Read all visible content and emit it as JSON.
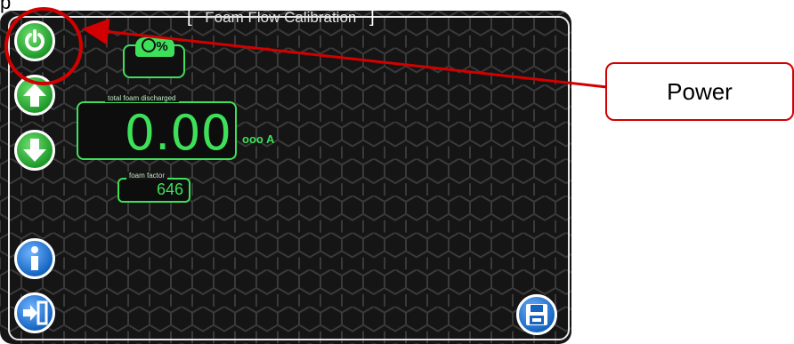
{
  "title_bar": {
    "fragment": "p",
    "title": "Foam Flow Calibration",
    "bracket_left": "[",
    "bracket_right": "]"
  },
  "sidebar": {
    "buttons": [
      {
        "name": "power",
        "icon": "power-icon",
        "color": "#2aa83a"
      },
      {
        "name": "up",
        "icon": "arrow-up-icon",
        "color": "#2aa83a"
      },
      {
        "name": "down",
        "icon": "arrow-down-icon",
        "color": "#2aa83a"
      },
      {
        "name": "info",
        "icon": "info-icon",
        "color": "#1e6fd0"
      },
      {
        "name": "exit",
        "icon": "exit-door-icon",
        "color": "#1e6fd0"
      }
    ]
  },
  "save_button": {
    "icon": "floppy-save-icon"
  },
  "percent_indicator": {
    "symbol": "%",
    "icon": "gauge-percent-icon",
    "value": ""
  },
  "total_foam": {
    "label": "total foam discharged",
    "value": "0.00",
    "unit": "ooo A"
  },
  "foam_factor": {
    "label": "foam factor",
    "value": "646"
  },
  "annotation": {
    "callout_text": "Power",
    "color": "#d20000"
  },
  "colors": {
    "accent": "#3ee05a",
    "screen_bg": "#151515"
  }
}
